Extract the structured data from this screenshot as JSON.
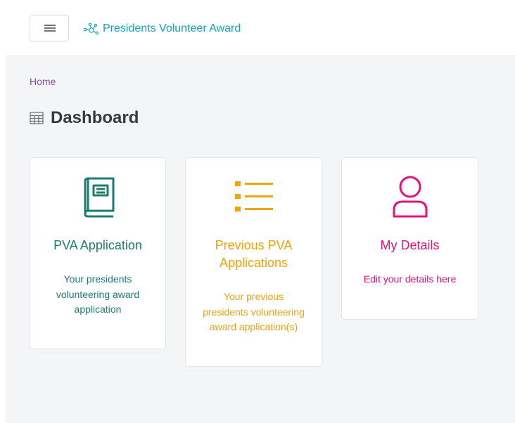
{
  "header": {
    "brand_title": "Presidents Volunteer Award",
    "menu_icon": "hamburger-menu-icon",
    "brand_icon": "network-nodes-icon"
  },
  "breadcrumb": {
    "home": "Home"
  },
  "page": {
    "title": "Dashboard",
    "title_icon": "table-grid-icon"
  },
  "cards": [
    {
      "title": "PVA Application",
      "description": "Your presidents volunteering award application",
      "icon": "book-icon",
      "color": "#1b7d70"
    },
    {
      "title": "Previous PVA Applications",
      "description": "Your previous presidents volunteering award application(s)",
      "icon": "list-icon",
      "color": "#f0a30a"
    },
    {
      "title": "My Details",
      "description": "Edit your details here",
      "icon": "user-icon",
      "color": "#e3137b"
    }
  ],
  "colors": {
    "accent": "#17a2b8",
    "breadcrumb": "#7b4fa8",
    "background": "#f4f5f7"
  }
}
